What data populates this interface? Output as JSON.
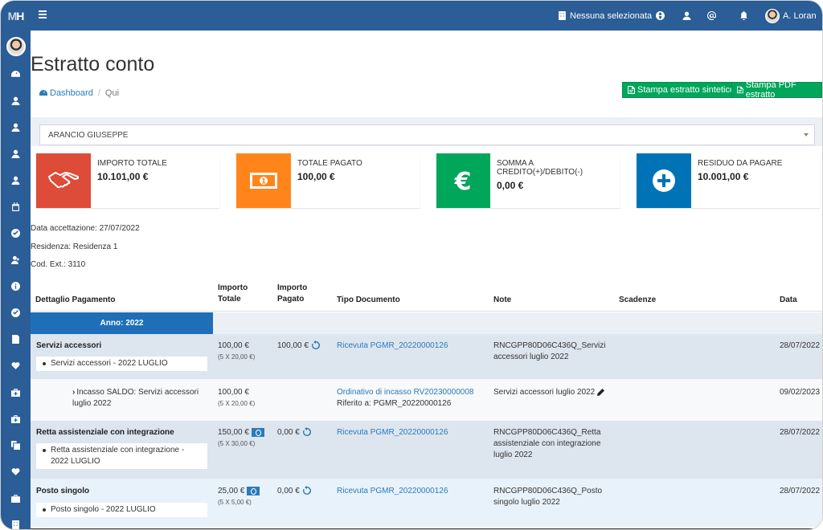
{
  "app": {
    "logo": "MH"
  },
  "topbar": {
    "facility": "Nessuna selezionata",
    "user_name": "A. Loran"
  },
  "page": {
    "title": "Estratto conto",
    "breadcrumb": {
      "home": "Dashboard",
      "current": "Qui"
    },
    "buttons": {
      "print_summary": "Stampa estratto sintetico",
      "print_pdf": "Stampa PDF estratto"
    },
    "selected_guest": "ARANCIO GIUSEPPE"
  },
  "info_boxes": [
    {
      "label": "IMPORTO TOTALE",
      "value": "10.101,00 €",
      "color": "#dd4b39",
      "icon": "handshake-icon"
    },
    {
      "label": "TOTALE PAGATO",
      "value": "100,00 €",
      "color": "#ff851b",
      "icon": "money-icon"
    },
    {
      "label": "SOMMA A CREDITO(+)/DEBITO(-)",
      "value": "0,00 €",
      "color": "#00a65a",
      "icon": "euro-icon"
    },
    {
      "label": "RESIDUO DA PAGARE",
      "value": "10.001,00 €",
      "color": "#0073b7",
      "icon": "plus-circle-icon"
    }
  ],
  "meta": {
    "acceptance": "Data accettazione: 27/07/2022",
    "residence": "Residenza: Residenza 1",
    "ext_code": "Cod. Ext.: 3110"
  },
  "table": {
    "headers": {
      "detail": "Dettaglio Pagamento",
      "total_1": "Importo",
      "total_2": "Totale",
      "paid_1": "Importo",
      "paid_2": "Pagato",
      "doc_type": "Tipo Documento",
      "notes": "Note",
      "due": "Scadenze",
      "date": "Data"
    },
    "year_label": "Anno: 2022",
    "rows": [
      {
        "title": "Servizi accessori",
        "item": "Servizi accessori - 2022 LUGLIO",
        "total": "100,00 €",
        "total_sub": "(5 X 20,00 €)",
        "paid": "100,00 €",
        "doc": "Ricevuta PGMR_20220000126",
        "note_1": "RNCGPP80D06C436Q_Servizi",
        "note_2": "accessori luglio 2022",
        "date": "28/07/2022"
      },
      {
        "detail_1": "Incasso SALDO: Servizi accessori",
        "detail_2": "luglio 2022",
        "total": "100,00 €",
        "total_sub": "(5 X 20,00 €)",
        "doc": "Ordinativo di incasso RV20230000008",
        "doc_ref": "Riferito a: PGMR_20220000126",
        "note": "Servizi accessori luglio 2022",
        "date": "09/02/2023"
      },
      {
        "title": "Retta assistenziale con integrazione",
        "item_1": "Retta assistenziale con integrazione -",
        "item_2": "2022 LUGLIO",
        "total": "150,00 €",
        "total_sub": "(5 X 30,00 €)",
        "paid": "0,00 €",
        "doc": "Ricevuta PGMR_20220000126",
        "note_1": "RNCGPP80D06C436Q_Retta",
        "note_2": "assistenziale con integrazione",
        "note_3": "luglio 2022",
        "date": "28/07/2022"
      },
      {
        "title": "Posto singolo",
        "item": "Posto singolo - 2022 LUGLIO",
        "total": "25,00 €",
        "total_sub": "(5 X 5,00 €)",
        "paid": "0,00 €",
        "doc": "Ricevuta PGMR_20220000126",
        "note_1": "RNCGPP80D06C436Q_Posto",
        "note_2": "singolo luglio 2022",
        "date": "28/07/2022"
      }
    ]
  }
}
